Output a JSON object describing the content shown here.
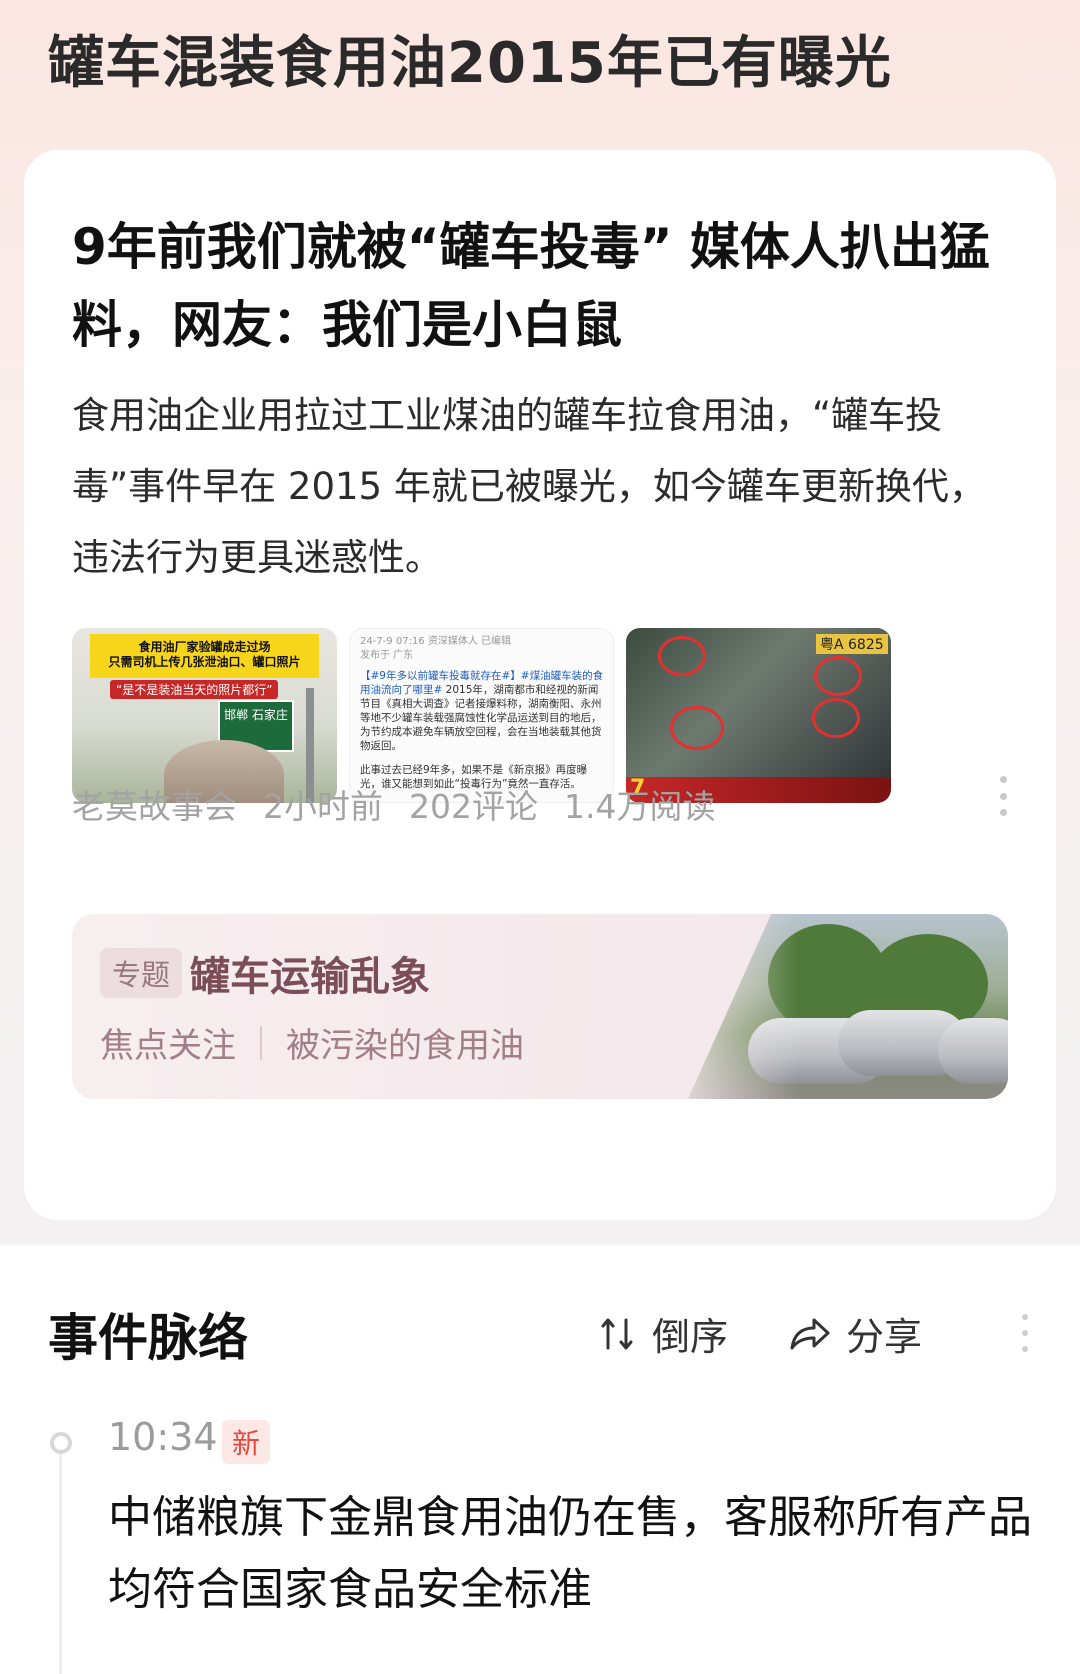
{
  "page_title": "罐车混装食用油2015年已有曝光",
  "article": {
    "title": "9年前我们就被“罐车投毒” 媒体人扒出猛料，网友：我们是小白鼠",
    "summary": "食用油企业用拉过工业煤油的罐车拉食用油，“罐车投毒”事件早在 2015 年就已被曝光，如今罐车更新换代，违法行为更具迷惑性。",
    "thumbnails": {
      "thumb1": {
        "banner_line1": "食用油厂家验罐成走过场",
        "banner_line2": "只需司机上传几张泄油口、罐口照片",
        "red_caption": "“是不是装油当天的照片都行”",
        "sign_text": "邯郸  石家庄"
      },
      "thumb2": {
        "header": "24-7-9 07:16  资深媒体人  已编辑",
        "header2": "发布于 广东",
        "hashtag": "【#9年多以前罐车投毒就存在#】#煤油罐车装的食用油流向了哪里#",
        "body": "2015年，湖南都市和经视的新闻节目《真相大调查》记者接爆料称，湖南衡阳、永州等地不少罐车装载强腐蚀性化学品运送到目的地后，为节约成本避免车辆放空回程，会在当地装载其他货物返回。",
        "body2": "此事过去已经9年多，如果不是《新京报》再度曝光，谁又能想到如此“投毒行为”竟然一直存活。"
      },
      "thumb3": {
        "plate": "粤A 6825",
        "channel_number": "7"
      }
    },
    "meta": {
      "source": "老莫故事会",
      "time": "2小时前",
      "comments": "202评论",
      "reads": "1.4万阅读"
    }
  },
  "topic": {
    "badge": "专题",
    "title": "罐车运输乱象",
    "links": [
      "焦点关注",
      "被污染的食用油"
    ]
  },
  "timeline": {
    "heading": "事件脉络",
    "sort_label": "倒序",
    "share_label": "分享",
    "items": [
      {
        "time": "10:34",
        "badge": "新",
        "text": "中储粮旗下金鼎食用油仍在售，客服称所有产品均符合国家食品安全标准"
      }
    ]
  },
  "colors": {
    "topic_title": "#7a4d57",
    "new_badge": "#e4483e",
    "meta_text": "#a3a3a3"
  }
}
